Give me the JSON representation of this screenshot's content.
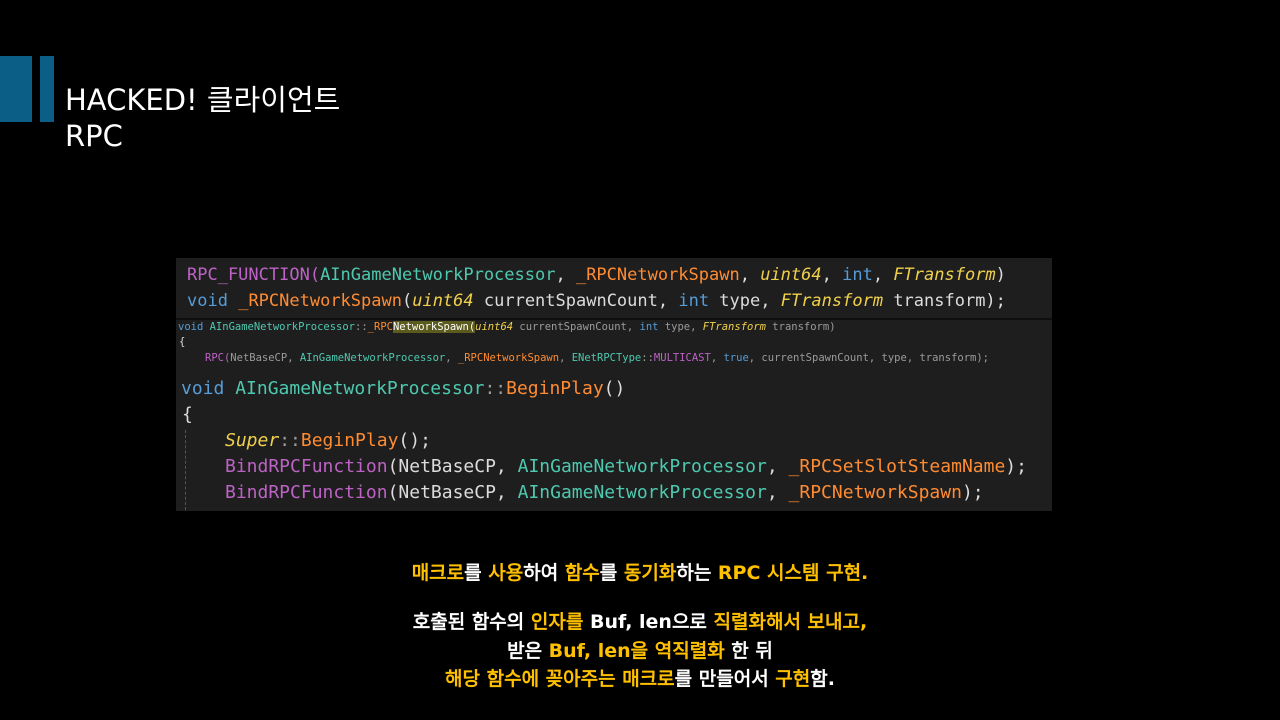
{
  "title": {
    "line1": "HACKED! 클라이언트",
    "line2": "RPC"
  },
  "code": {
    "top": {
      "l1": [
        "RPC_FUNCTION(",
        "AInGameNetworkProcessor",
        ", ",
        "_RPCNetworkSpawn",
        ", ",
        "uint64",
        ", ",
        "int",
        ", ",
        "FTransform",
        ")"
      ],
      "l2": [
        "void",
        " ",
        "_RPCNetworkSpawn",
        "(",
        "uint64",
        " currentSpawnCount, ",
        "int",
        " type, ",
        "FTransform",
        " transform);"
      ]
    },
    "mid": {
      "l1": [
        "void ",
        "AInGameNetworkProcessor",
        "::",
        "_RPC",
        "NetworkSpawn(",
        "uint64",
        " currentSpawnCount, ",
        "int",
        " type, ",
        "FTransform",
        " transform)"
      ],
      "l2": "{",
      "l3": [
        "RPC(",
        "NetBaseCP, ",
        "AInGameNetworkProcessor",
        ", ",
        "_RPCNetworkSpawn",
        ", ",
        "ENetRPCType",
        "::",
        "MULTICAST",
        ", ",
        "true",
        ", currentSpawnCount, type, transform);"
      ]
    },
    "bot": {
      "l1": [
        "void ",
        "AInGameNetworkProcessor",
        "::",
        "BeginPlay",
        "()"
      ],
      "l2": "{",
      "l3": [
        "Super",
        "::",
        "BeginPlay",
        "();"
      ],
      "l4": [
        "BindRPCFunction",
        "(NetBaseCP, ",
        "AInGameNetworkProcessor",
        ", ",
        "_RPCSetSlotSteamName",
        ");"
      ],
      "l5": [
        "BindRPCFunction",
        "(NetBaseCP, ",
        "AInGameNetworkProcessor",
        ", ",
        "_RPCNetworkSpawn",
        ");"
      ]
    }
  },
  "description": {
    "p1": [
      "매크로",
      "를 ",
      "사용",
      "하여 ",
      "함수",
      "를 ",
      "동기화",
      "하는 ",
      "RPC 시스템 구현."
    ],
    "p2": [
      "호출된 함수의 ",
      "인자를",
      " Buf, len",
      "으로 ",
      "직렬화해서 보내고,"
    ],
    "p3": [
      "받은 ",
      "Buf, len을 ",
      "역직렬화",
      " 한 뒤"
    ],
    "p4": [
      "해당 함수에 꽂아주는 ",
      "매크로",
      "를 만들어서 ",
      "구현",
      "함."
    ]
  },
  "colors": {
    "accent": "#0b5f86",
    "highlight": "#ffc000"
  }
}
